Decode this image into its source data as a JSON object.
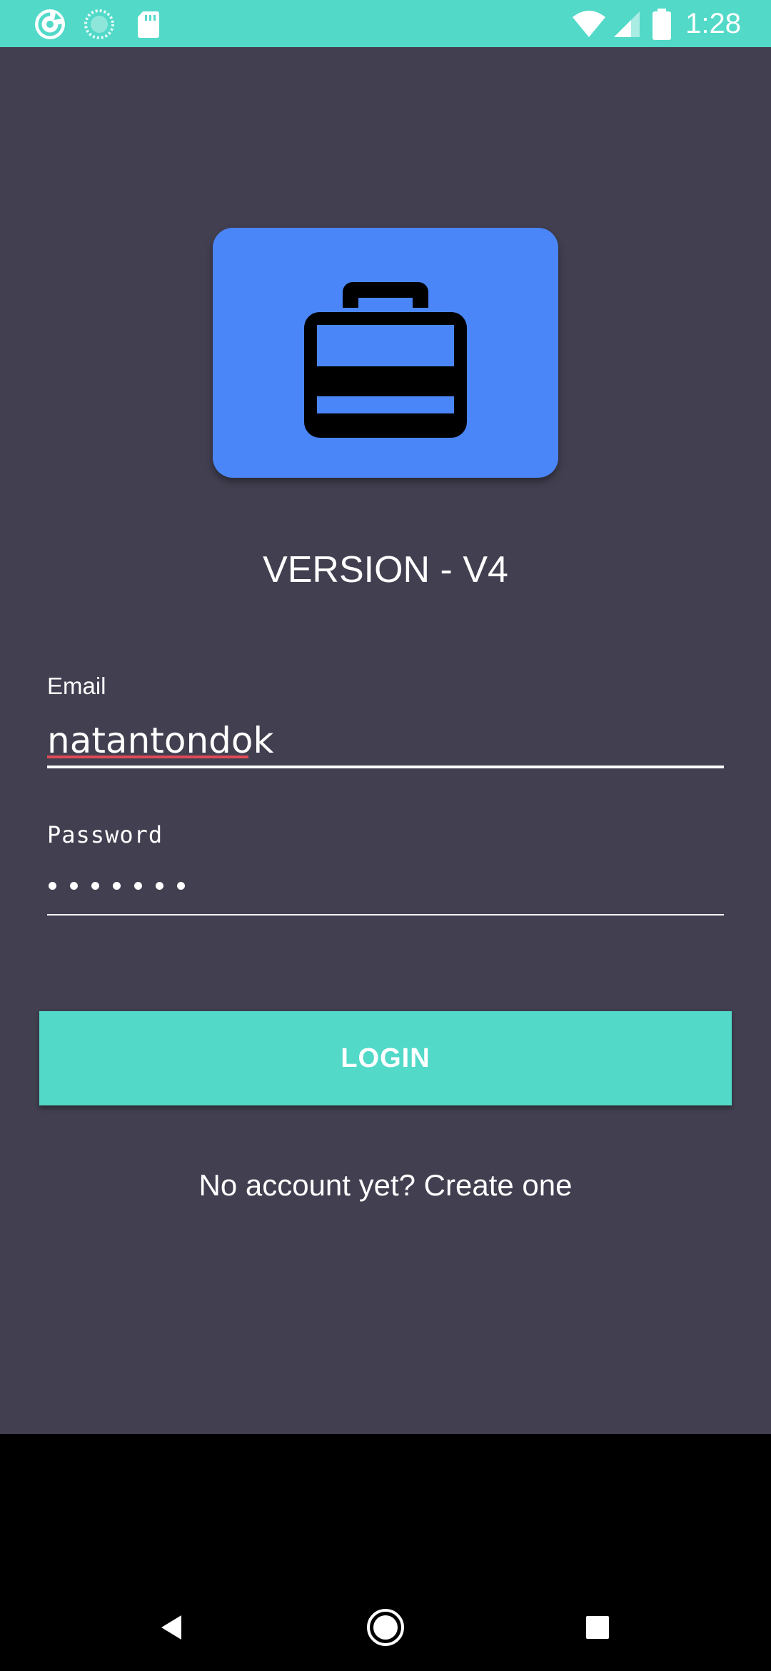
{
  "status_bar": {
    "time": "1:28",
    "left_icons": [
      "app-refresh-icon",
      "loading-circle-icon",
      "sd-card-icon"
    ],
    "right_icons": [
      "wifi-icon",
      "cell-signal-icon",
      "battery-icon"
    ],
    "background": "#52d9c8"
  },
  "app": {
    "logo_icon": "briefcase-icon",
    "logo_color": "#4a86f7",
    "version_text": "VERSION - V4",
    "background": "#423f50"
  },
  "form": {
    "email_label": "Email",
    "email_value": "natantondok",
    "password_label": "Password",
    "password_length": 7,
    "login_label": "LOGIN",
    "create_account_text": "No account yet? Create one",
    "accent": "#52d9c8"
  },
  "nav_bar": {
    "buttons": [
      "back-icon",
      "home-icon",
      "recents-icon"
    ]
  }
}
